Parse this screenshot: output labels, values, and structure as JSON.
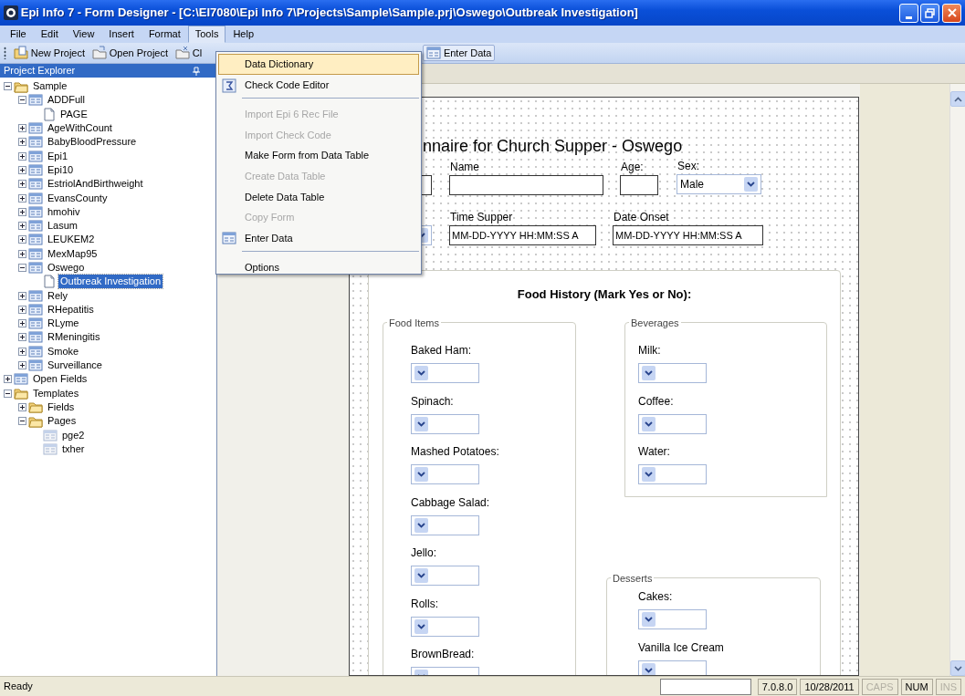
{
  "window": {
    "title": "Epi Info 7 - Form Designer - [C:\\EI7080\\Epi Info 7\\Projects\\Sample\\Sample.prj\\Oswego\\Outbreak Investigation]"
  },
  "menu": [
    {
      "label": "File",
      "selected": false
    },
    {
      "label": "Edit",
      "selected": false
    },
    {
      "label": "View",
      "selected": false
    },
    {
      "label": "Insert",
      "selected": false
    },
    {
      "label": "Format",
      "selected": false
    },
    {
      "label": "Tools",
      "selected": true
    },
    {
      "label": "Help",
      "selected": false
    }
  ],
  "toolbar": [
    {
      "label": "New Project"
    },
    {
      "label": "Open Project"
    },
    {
      "label": "Cl"
    },
    {
      "label": "Enter Data"
    }
  ],
  "project_explorer": {
    "title": "Project Explorer",
    "tree": [
      {
        "label": "Sample",
        "kind": "folder",
        "expanded": true,
        "selected": false,
        "children": [
          {
            "label": "ADDFull",
            "kind": "form",
            "expanded": true,
            "selected": false,
            "children": [
              {
                "label": "PAGE",
                "kind": "page",
                "selected": false
              }
            ]
          },
          {
            "label": "AgeWithCount",
            "kind": "form",
            "expanded": false,
            "selected": false
          },
          {
            "label": "BabyBloodPressure",
            "kind": "form",
            "expanded": false,
            "selected": false
          },
          {
            "label": "Epi1",
            "kind": "form",
            "expanded": false,
            "selected": false
          },
          {
            "label": "Epi10",
            "kind": "form",
            "expanded": false,
            "selected": false
          },
          {
            "label": "EstriolAndBirthweight",
            "kind": "form",
            "expanded": false,
            "selected": false
          },
          {
            "label": "EvansCounty",
            "kind": "form",
            "expanded": false,
            "selected": false
          },
          {
            "label": "hmohiv",
            "kind": "form",
            "expanded": false,
            "selected": false
          },
          {
            "label": "Lasum",
            "kind": "form",
            "expanded": false,
            "selected": false
          },
          {
            "label": "LEUKEM2",
            "kind": "form",
            "expanded": false,
            "selected": false
          },
          {
            "label": "MexMap95",
            "kind": "form",
            "expanded": false,
            "selected": false
          },
          {
            "label": "Oswego",
            "kind": "form",
            "expanded": true,
            "selected": false,
            "children": [
              {
                "label": "Outbreak Investigation",
                "kind": "page",
                "selected": true
              }
            ]
          },
          {
            "label": "Rely",
            "kind": "form",
            "expanded": false,
            "selected": false
          },
          {
            "label": "RHepatitis",
            "kind": "form",
            "expanded": false,
            "selected": false
          },
          {
            "label": "RLyme",
            "kind": "form",
            "expanded": false,
            "selected": false
          },
          {
            "label": "RMeningitis",
            "kind": "form",
            "expanded": false,
            "selected": false
          },
          {
            "label": "Smoke",
            "kind": "form",
            "expanded": false,
            "selected": false
          },
          {
            "label": "Surveillance",
            "kind": "form",
            "expanded": false,
            "selected": false
          }
        ]
      },
      {
        "label": "Open Fields",
        "kind": "form",
        "expanded": false,
        "selected": false
      },
      {
        "label": "Templates",
        "kind": "folder",
        "expanded": true,
        "selected": false,
        "children": [
          {
            "label": "Fields",
            "kind": "folder",
            "expanded": false,
            "selected": false
          },
          {
            "label": "Pages",
            "kind": "folder",
            "expanded": true,
            "selected": false,
            "children": [
              {
                "label": "pge2",
                "kind": "template",
                "selected": false
              },
              {
                "label": "txher",
                "kind": "template",
                "selected": false
              }
            ]
          }
        ]
      }
    ]
  },
  "tools_menu": [
    {
      "kind": "item",
      "label": "Data Dictionary",
      "selected": true,
      "disabled": false
    },
    {
      "kind": "item",
      "label": "Check Code Editor",
      "selected": false,
      "disabled": false
    },
    {
      "kind": "separator"
    },
    {
      "kind": "item",
      "label": "Import Epi 6 Rec File",
      "selected": false,
      "disabled": true
    },
    {
      "kind": "item",
      "label": "Import Check Code",
      "selected": false,
      "disabled": true
    },
    {
      "kind": "item",
      "label": "Make Form from Data Table",
      "selected": false,
      "disabled": false
    },
    {
      "kind": "item",
      "label": "Create Data Table",
      "selected": false,
      "disabled": true
    },
    {
      "kind": "item",
      "label": "Delete Data Table",
      "selected": false,
      "disabled": false
    },
    {
      "kind": "item",
      "label": "Copy Form",
      "selected": false,
      "disabled": true
    },
    {
      "kind": "item",
      "label": "Enter Data",
      "selected": false,
      "disabled": false
    },
    {
      "kind": "separator"
    },
    {
      "kind": "item",
      "label": "Options",
      "selected": false,
      "disabled": false
    }
  ],
  "form": {
    "title": "nnaire for Church Supper - Oswego",
    "fields": [
      {
        "kind": "text"
      },
      {
        "kind": "text",
        "label": "Name"
      },
      {
        "kind": "text",
        "label": "Age:"
      },
      {
        "kind": "select",
        "label": "Sex:",
        "value": "Male"
      },
      {
        "kind": "select"
      },
      {
        "kind": "text",
        "label": "Time Supper",
        "value": "MM-DD-YYYY HH:MM:SS A"
      },
      {
        "kind": "text",
        "label": "Date Onset",
        "value": "MM-DD-YYYY HH:MM:SS A"
      }
    ],
    "group": {
      "title": "Food History (Mark Yes or No):",
      "sections": [
        {
          "legend": "Food Items",
          "fields": [
            {
              "label": "Baked Ham:",
              "kind": "select"
            },
            {
              "label": "Spinach:",
              "kind": "select"
            },
            {
              "label": "Mashed Potatoes:",
              "kind": "select"
            },
            {
              "label": "Cabbage Salad:",
              "kind": "select"
            },
            {
              "label": "Jello:",
              "kind": "select"
            },
            {
              "label": "Rolls:",
              "kind": "select"
            },
            {
              "label": "BrownBread:",
              "kind": "select"
            }
          ]
        },
        {
          "legend": "Beverages",
          "fields": [
            {
              "label": "Milk:",
              "kind": "select"
            },
            {
              "label": "Coffee:",
              "kind": "select"
            },
            {
              "label": "Water:",
              "kind": "select"
            }
          ]
        },
        {
          "legend": "Desserts",
          "fields": [
            {
              "label": "Cakes:",
              "kind": "select"
            },
            {
              "label": "Vanilla Ice Cream",
              "kind": "select"
            }
          ]
        }
      ]
    }
  },
  "status_bar": {
    "text": "Ready",
    "panels": [
      {
        "text": "7.0.8.0",
        "disabled": false
      },
      {
        "text": "10/28/2011",
        "disabled": false
      },
      {
        "text": "CAPS",
        "disabled": true
      },
      {
        "text": "NUM",
        "disabled": false
      },
      {
        "text": "INS",
        "disabled": true
      }
    ]
  }
}
